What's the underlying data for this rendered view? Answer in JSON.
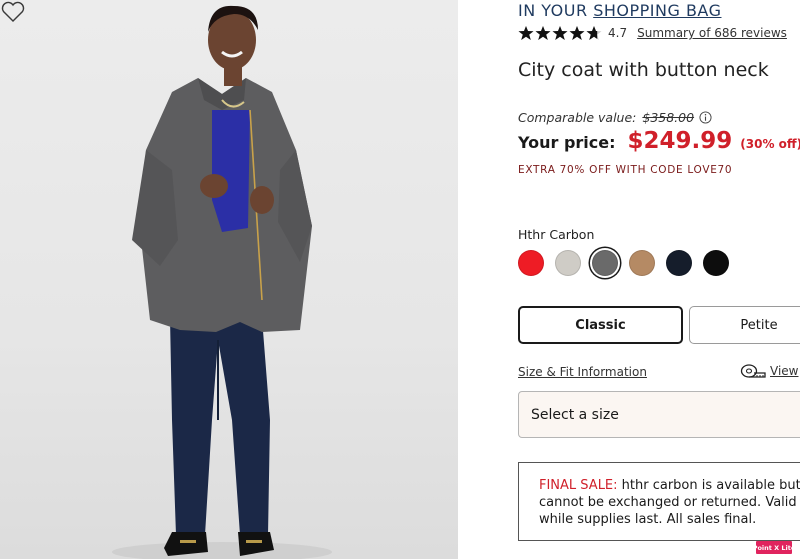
{
  "header": {
    "in_your": "IN YOUR",
    "shopping_bag_link": "SHOPPING BAG"
  },
  "rating": {
    "value": "4.7",
    "stars": 4.7,
    "reviews_link": "Summary of 686 reviews"
  },
  "product": {
    "title": "City coat with button neck"
  },
  "pricing": {
    "comparable_label": "Comparable value:",
    "comparable_value": "$358.00",
    "your_price_label": "Your price:",
    "your_price": "$249.99",
    "discount": "(30% off)",
    "promo": "EXTRA 70% OFF WITH CODE LOVE70"
  },
  "color": {
    "selected_name": "Hthr Carbon",
    "swatches": [
      {
        "name": "red",
        "hex": "#ee1c25"
      },
      {
        "name": "heather-ivory",
        "hex": "#cfccc6"
      },
      {
        "name": "hthr-carbon",
        "hex": "#6a6a6a",
        "selected": true
      },
      {
        "name": "camel",
        "hex": "#b58a64"
      },
      {
        "name": "navy",
        "hex": "#151d2b"
      },
      {
        "name": "black",
        "hex": "#0d0d0d"
      }
    ]
  },
  "fit": {
    "classic_label": "Classic",
    "petite_label": "Petite",
    "selected": "Classic"
  },
  "size_info": {
    "size_fit_link": "Size & Fit Information",
    "view_link": "View"
  },
  "size_select": {
    "placeholder": "Select a size"
  },
  "final_sale": {
    "label": "FINAL SALE:",
    "line1_rest": "hthr carbon is available but",
    "line2": "cannot be exchanged or returned. Valid",
    "line3": "while supplies last. All sales final."
  },
  "badge": {
    "text": "Point X Lite"
  },
  "colors": {
    "price_red": "#d0202a",
    "link_navy": "#1f3a5f",
    "promo_maroon": "#7a1a1a",
    "select_bg": "#fbf6f2"
  }
}
